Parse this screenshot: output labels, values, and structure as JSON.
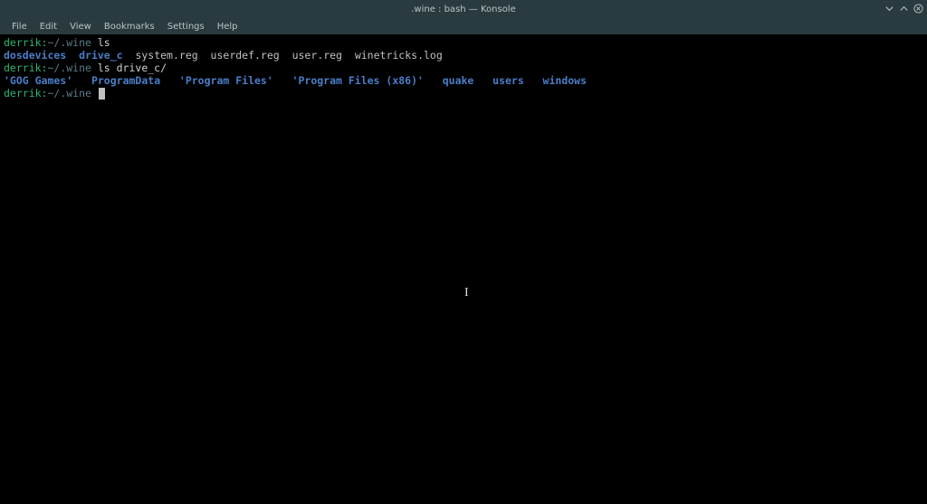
{
  "titlebar": {
    "title": ".wine : bash — Konsole"
  },
  "menubar": {
    "items": [
      {
        "label": "File"
      },
      {
        "label": "Edit"
      },
      {
        "label": "View"
      },
      {
        "label": "Bookmarks"
      },
      {
        "label": "Settings"
      },
      {
        "label": "Help"
      }
    ]
  },
  "terminal": {
    "prompt_user": "derrik:",
    "prompt_path": "~/.wine",
    "lines": {
      "l1_cmd": "ls",
      "l2_dirs": [
        "dosdevices",
        "drive_c"
      ],
      "l2_files": [
        "system.reg",
        "userdef.reg",
        "user.reg",
        "winetricks.log"
      ],
      "l3_cmd": "ls drive_c/",
      "l4_items": [
        {
          "text": "'GOG Games'",
          "cls": "c-qdir"
        },
        {
          "text": "ProgramData",
          "cls": "c-dir"
        },
        {
          "text": "'Program Files'",
          "cls": "c-qdir"
        },
        {
          "text": "'Program Files (x86)'",
          "cls": "c-qdir"
        },
        {
          "text": "quake",
          "cls": "c-dir"
        },
        {
          "text": "users",
          "cls": "c-dir"
        },
        {
          "text": "windows",
          "cls": "c-dir"
        }
      ]
    }
  }
}
